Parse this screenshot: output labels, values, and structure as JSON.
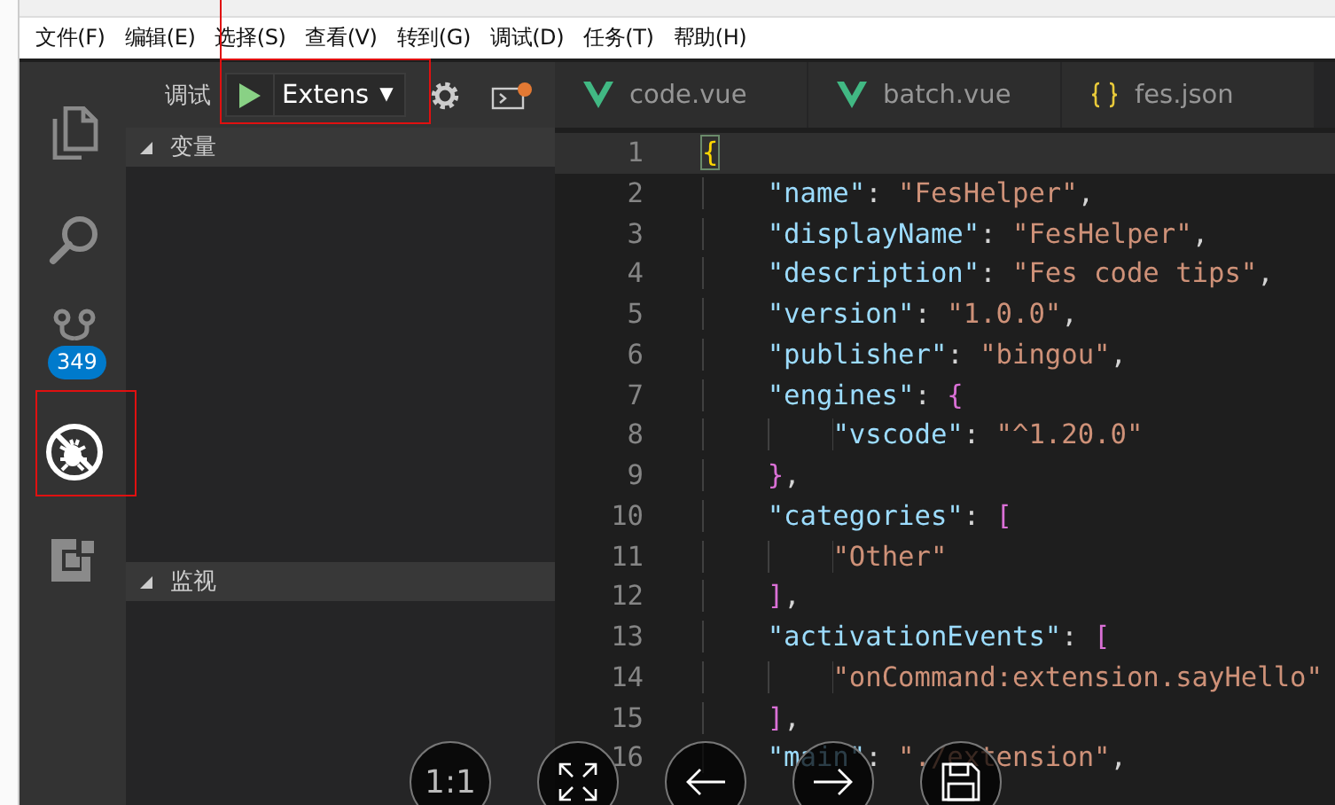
{
  "menu": [
    "文件(F)",
    "编辑(E)",
    "选择(S)",
    "查看(V)",
    "转到(G)",
    "调试(D)",
    "任务(T)",
    "帮助(H)"
  ],
  "activity_bar": [
    {
      "kind": "files",
      "selected": false
    },
    {
      "kind": "search",
      "selected": false
    },
    {
      "kind": "git",
      "selected": false,
      "badge": "349"
    },
    {
      "kind": "debug",
      "selected": true
    },
    {
      "kind": "extensions",
      "selected": false
    }
  ],
  "debug_toolbar": {
    "label": "调试",
    "configuration": "Extens",
    "caret": "▼"
  },
  "sidebar": {
    "sections": [
      {
        "title": "变量",
        "expanded": true
      },
      {
        "title": "监视",
        "expanded": true
      }
    ]
  },
  "tabs": [
    {
      "label": "code.vue",
      "kind": "vue",
      "selected": false
    },
    {
      "label": "batch.vue",
      "kind": "vue",
      "selected": false
    },
    {
      "label": "fes.json",
      "kind": "json",
      "selected": false
    }
  ],
  "code": [
    {
      "number": "1",
      "current": true,
      "tokens": [
        {
          "kind": "bracket",
          "text": "{",
          "color": "#ffd700"
        }
      ]
    },
    {
      "number": "2",
      "current": false,
      "tokens": [
        {
          "kind": "key",
          "text": "    \"name\""
        },
        {
          "kind": "punct",
          "text": ": "
        },
        {
          "kind": "string",
          "text": "\"FesHelper\""
        },
        {
          "kind": "punct",
          "text": ","
        }
      ]
    },
    {
      "number": "3",
      "current": false,
      "tokens": [
        {
          "kind": "key",
          "text": "    \"displayName\""
        },
        {
          "kind": "punct",
          "text": ": "
        },
        {
          "kind": "string",
          "text": "\"FesHelper\""
        },
        {
          "kind": "punct",
          "text": ","
        }
      ]
    },
    {
      "number": "4",
      "current": false,
      "tokens": [
        {
          "kind": "key",
          "text": "    \"description\""
        },
        {
          "kind": "punct",
          "text": ": "
        },
        {
          "kind": "string",
          "text": "\"Fes code tips\""
        },
        {
          "kind": "punct",
          "text": ","
        }
      ]
    },
    {
      "number": "5",
      "current": false,
      "tokens": [
        {
          "kind": "key",
          "text": "    \"version\""
        },
        {
          "kind": "punct",
          "text": ": "
        },
        {
          "kind": "string",
          "text": "\"1.0.0\""
        },
        {
          "kind": "punct",
          "text": ","
        }
      ]
    },
    {
      "number": "6",
      "current": false,
      "tokens": [
        {
          "kind": "key",
          "text": "    \"publisher\""
        },
        {
          "kind": "punct",
          "text": ": "
        },
        {
          "kind": "string",
          "text": "\"bingou\""
        },
        {
          "kind": "punct",
          "text": ","
        }
      ]
    },
    {
      "number": "7",
      "current": false,
      "tokens": [
        {
          "kind": "key",
          "text": "    \"engines\""
        },
        {
          "kind": "punct",
          "text": ": "
        },
        {
          "kind": "bracket",
          "text": "{",
          "color": "#da70d6"
        }
      ]
    },
    {
      "number": "8",
      "current": false,
      "tokens": [
        {
          "kind": "key",
          "text": "        \"vscode\""
        },
        {
          "kind": "punct",
          "text": ": "
        },
        {
          "kind": "string",
          "text": "\"^1.20.0\""
        }
      ]
    },
    {
      "number": "9",
      "current": false,
      "tokens": [
        {
          "kind": "bracket",
          "text": "    }",
          "color": "#da70d6"
        },
        {
          "kind": "punct",
          "text": ","
        }
      ]
    },
    {
      "number": "10",
      "current": false,
      "tokens": [
        {
          "kind": "key",
          "text": "    \"categories\""
        },
        {
          "kind": "punct",
          "text": ": "
        },
        {
          "kind": "bracket",
          "text": "[",
          "color": "#da70d6"
        }
      ]
    },
    {
      "number": "11",
      "current": false,
      "tokens": [
        {
          "kind": "string",
          "text": "        \"Other\""
        }
      ]
    },
    {
      "number": "12",
      "current": false,
      "tokens": [
        {
          "kind": "bracket",
          "text": "    ]",
          "color": "#da70d6"
        },
        {
          "kind": "punct",
          "text": ","
        }
      ]
    },
    {
      "number": "13",
      "current": false,
      "tokens": [
        {
          "kind": "key",
          "text": "    \"activationEvents\""
        },
        {
          "kind": "punct",
          "text": ": "
        },
        {
          "kind": "bracket",
          "text": "[",
          "color": "#da70d6"
        }
      ]
    },
    {
      "number": "14",
      "current": false,
      "tokens": [
        {
          "kind": "string",
          "text": "        \"onCommand:extension.sayHello\""
        }
      ]
    },
    {
      "number": "15",
      "current": false,
      "tokens": [
        {
          "kind": "bracket",
          "text": "    ]",
          "color": "#da70d6"
        },
        {
          "kind": "punct",
          "text": ","
        }
      ]
    },
    {
      "number": "16",
      "current": false,
      "tokens": [
        {
          "kind": "key",
          "text": "    \"main\""
        },
        {
          "kind": "punct",
          "text": ": "
        },
        {
          "kind": "string",
          "text": "\"./extension\""
        },
        {
          "kind": "punct",
          "text": ","
        }
      ]
    }
  ],
  "viewer_controls": [
    {
      "kind": "actual-size",
      "text": "1:1"
    },
    {
      "kind": "fit"
    },
    {
      "kind": "previous"
    },
    {
      "kind": "next"
    },
    {
      "kind": "save"
    }
  ]
}
